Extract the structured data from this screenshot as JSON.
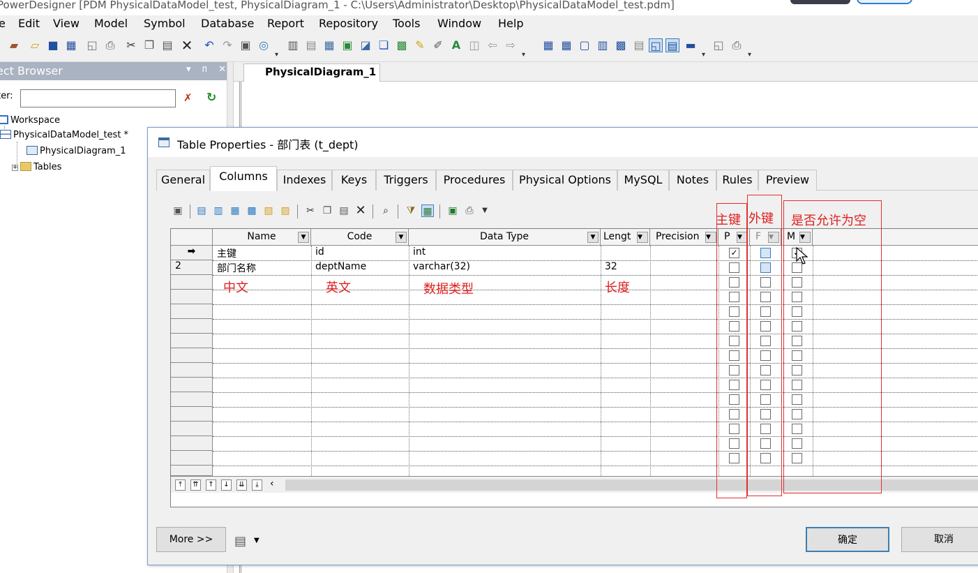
{
  "window": {
    "title": "PowerDesigner [PDM PhysicalDataModel_test, PhysicalDiagram_1 - C:\\Users\\Administrator\\Desktop\\PhysicalDataModel_test.pdm]"
  },
  "menu": [
    "e",
    "Edit",
    "View",
    "Model",
    "Symbol",
    "Database",
    "Report",
    "Repository",
    "Tools",
    "Window",
    "Help"
  ],
  "object_browser": {
    "header": "ect Browser",
    "controls": "▾ ᴨ ✕",
    "filter_label": "ter:",
    "filter_value": "",
    "tree": {
      "workspace": "Workspace",
      "model": "PhysicalDataModel_test *",
      "diagram": "PhysicalDiagram_1",
      "tables": "Tables"
    }
  },
  "document_tab": "PhysicalDiagram_1",
  "dialog": {
    "title": "Table Properties - 部门表 (t_dept)",
    "tabs": [
      "General",
      "Columns",
      "Indexes",
      "Keys",
      "Triggers",
      "Procedures",
      "Physical Options",
      "MySQL",
      "Notes",
      "Rules",
      "Preview"
    ],
    "active_tab": "Columns",
    "columns": {
      "headers": [
        "Name",
        "Code",
        "Data Type",
        "Lengt",
        "Precision",
        "P",
        "F",
        "M"
      ],
      "rows": [
        {
          "marker": "➡",
          "name": "主键",
          "code": "id",
          "data_type": "int",
          "length": "",
          "precision": "",
          "p": true,
          "f": false,
          "m": true
        },
        {
          "marker": "2",
          "name": "部门名称",
          "code": "deptName",
          "data_type": "varchar(32)",
          "length": "32",
          "precision": "",
          "p": false,
          "f": false,
          "m": false
        }
      ]
    },
    "annotations": {
      "pk": "主键",
      "fk": "外键",
      "nullable": "是否允许为空",
      "chinese": "中文",
      "english": "英文",
      "datatype": "数据类型",
      "length": "长度"
    },
    "more_button": "More >>",
    "ok_button": "确定",
    "cancel_button": "取消"
  },
  "colors": {
    "annotation": "#e02020",
    "header": "#a9b3c1",
    "accent": "#3c7fb1"
  }
}
